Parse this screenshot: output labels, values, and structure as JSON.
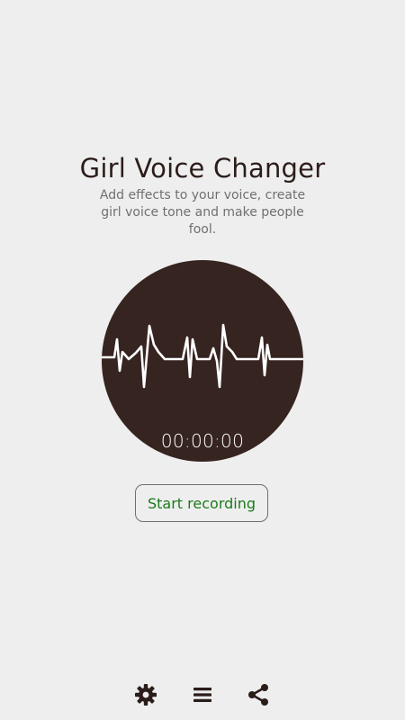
{
  "header": {
    "title": "Girl Voice Changer",
    "subtitle": "Add effects to your voice, create girl voice tone and make people fool."
  },
  "recorder": {
    "timer": "00:00:00",
    "background_color": "#362420",
    "waveform_color": "#ffffff"
  },
  "actions": {
    "start_recording_label": "Start recording",
    "start_recording_color": "#1b7a1b"
  },
  "bottom_bar": {
    "icons": [
      "settings-gear-icon",
      "menu-icon",
      "share-icon"
    ]
  }
}
